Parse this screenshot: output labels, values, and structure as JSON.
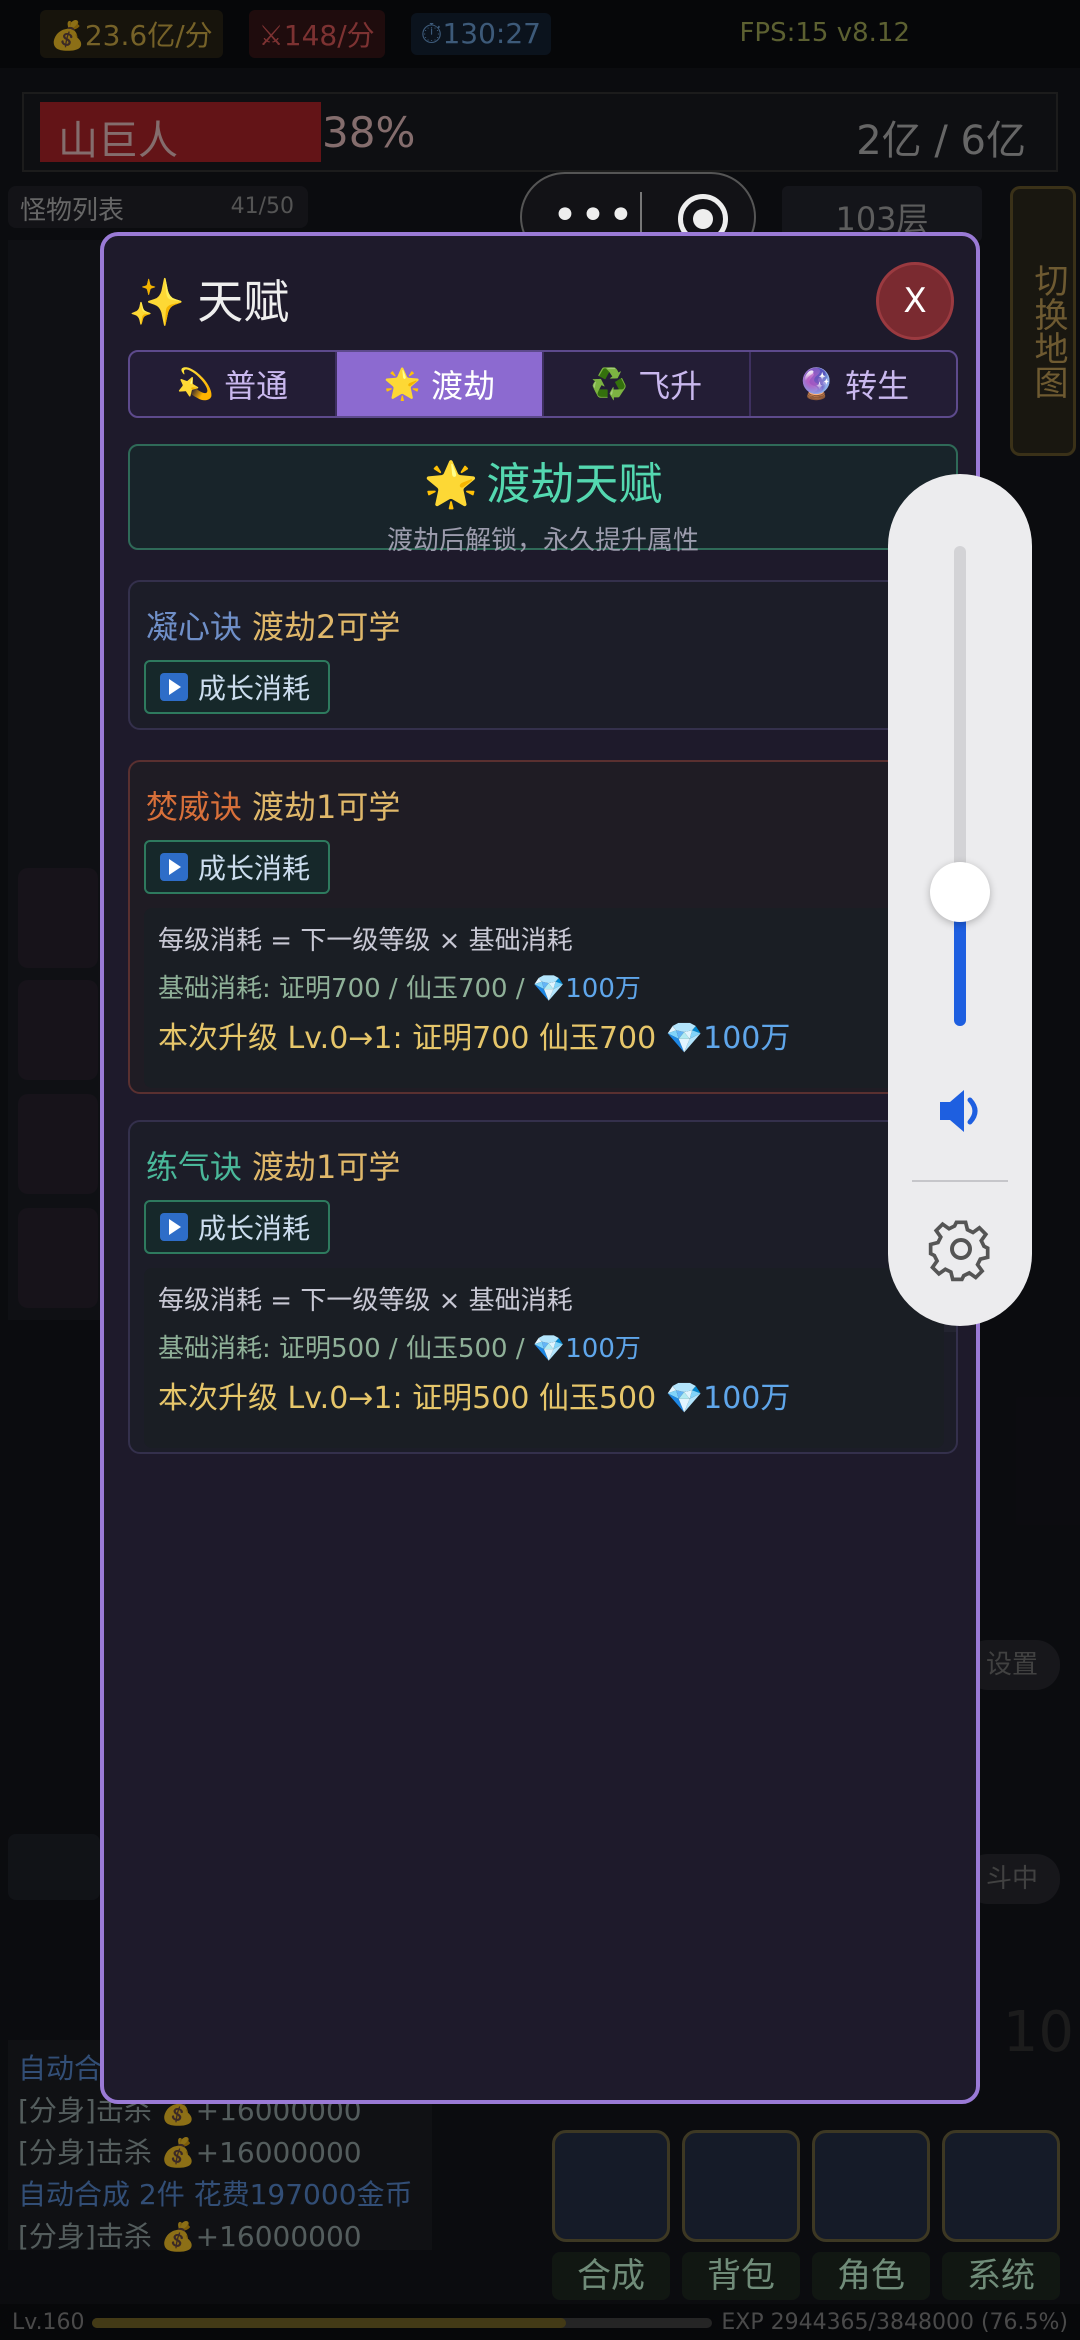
{
  "topbar": {
    "gold": "💰23.6亿/分",
    "kills": "⚔148/分",
    "timer": "⏱130:27",
    "fps": "FPS:15 v8.12"
  },
  "boss": {
    "name": "山巨人",
    "percent_text": "38%",
    "hp_fraction": 0.38,
    "hp": "2亿 / 6亿"
  },
  "monster_list": {
    "label": "怪物列表",
    "count": "41/50"
  },
  "floor": "103层",
  "switch_map": "切换地图",
  "log": {
    "lines": [
      {
        "text": "自动合成",
        "type": "blue"
      },
      {
        "text": "[分身]击杀 💰+16000000",
        "type": "normal"
      },
      {
        "text": "[分身]击杀 💰+16000000",
        "type": "normal"
      },
      {
        "text": "自动合成 2件 花费197000金币",
        "type": "blue"
      },
      {
        "text": "[分身]击杀 💰+16000000",
        "type": "normal"
      }
    ]
  },
  "side_buttons": {
    "settings": "设置",
    "fighting": "斗中"
  },
  "big_number": "10",
  "bottom_nav": [
    {
      "label": "合成",
      "icon": "crystal-ball-icon"
    },
    {
      "label": "背包",
      "icon": "backpack-icon"
    },
    {
      "label": "角色",
      "icon": "person-icon"
    },
    {
      "label": "系统",
      "icon": "gear-icon"
    }
  ],
  "exp": {
    "level": "Lv.160",
    "text": "EXP 2944365/3848000 (76.5%)",
    "fraction": 0.765
  },
  "capsule": {
    "dots": "•••"
  },
  "modal": {
    "title_icon": "✨",
    "title": "天赋",
    "close_label": "X",
    "tabs": [
      {
        "icon": "💫",
        "label": "普通",
        "active": false
      },
      {
        "icon": "🌟",
        "label": "渡劫",
        "active": true
      },
      {
        "icon": "♻️",
        "label": "飞升",
        "active": false
      },
      {
        "icon": "🔮",
        "label": "转生",
        "active": false
      }
    ],
    "section": {
      "icon": "🌟",
      "title": "渡劫天赋",
      "subtitle": "渡劫后解锁，永久提升属性"
    },
    "cards": [
      {
        "name": "凝心诀",
        "name_color": "#6f8fc8",
        "requirement": "渡劫2可学",
        "button": "成长消耗",
        "lock": "🔒"
      },
      {
        "name": "焚威诀",
        "name_color": "#d8703a",
        "requirement": "渡劫1可学",
        "button": "成长消耗",
        "lock": "🔒",
        "formula": "每级消耗 = 下一级等级 × 基础消耗",
        "base_cost": "基础消耗: 证明700 / 仙玉700 / ",
        "base_gem": "💎100万",
        "upgrade": "本次升级 Lv.0→1: 证明700 仙玉700 ",
        "upgrade_gem": "💎100万"
      },
      {
        "name": "练气诀",
        "name_color": "#4ab89a",
        "requirement": "渡劫1可学",
        "button": "成长消耗",
        "lock": "🔒",
        "formula": "每级消耗 = 下一级等级 × 基础消耗",
        "base_cost": "基础消耗: 证明500 / 仙玉500 / ",
        "base_gem": "💎100万",
        "upgrade": "本次升级 Lv.0→1: 证明500 仙玉500 ",
        "upgrade_gem": "💎100万"
      }
    ]
  },
  "volume": {
    "level": 0.28,
    "accent": "#1e5fe0"
  }
}
